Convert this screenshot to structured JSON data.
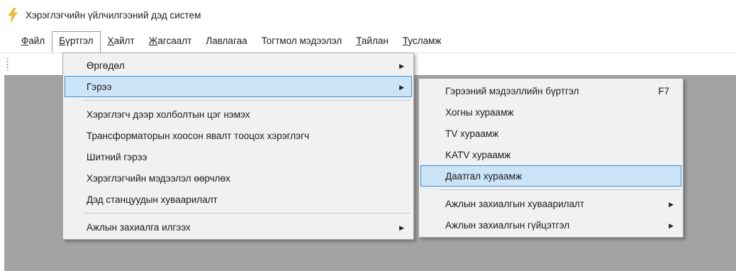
{
  "window": {
    "title": "Хэрэглэгчийн үйлчилгээний дэд систем"
  },
  "menubar": {
    "items": [
      {
        "mn": "Ф",
        "rest": "айл",
        "name": "menu-file"
      },
      {
        "mn": "Б",
        "rest": "үртгэл",
        "name": "menu-burtgel"
      },
      {
        "mn": "Х",
        "rest": "айлт",
        "name": "menu-search"
      },
      {
        "mn": "Ж",
        "rest": "агсаалт",
        "name": "menu-list"
      },
      {
        "mn": "",
        "rest": "Лавлагаа",
        "name": "menu-reference"
      },
      {
        "mn": "",
        "rest": "Тогтмол мэдээлэл",
        "name": "menu-constants"
      },
      {
        "mn": "Т",
        "rest": "айлан",
        "name": "menu-report"
      },
      {
        "mn": "Т",
        "rest": "усламж",
        "name": "menu-help"
      }
    ],
    "active_index": 1
  },
  "burtgel_menu": {
    "items": [
      {
        "label": "Өргөдөл",
        "submenu": true
      },
      {
        "label": "Гэрээ",
        "submenu": true,
        "highlight": true
      },
      {
        "sep": true
      },
      {
        "label": "Хэрэглэгч дээр холболтын цэг нэмэх"
      },
      {
        "label": "Трансформаторын хоосон явалт тооцох хэрэглэгч"
      },
      {
        "label": "Шитний гэрээ"
      },
      {
        "label": "Хэрэглэгчийн мэдээлэл өөрчлөх"
      },
      {
        "label": "Дэд станцуудын хуваарилалт"
      },
      {
        "sep": true
      },
      {
        "label": "Ажлын захиалга илгээх",
        "submenu": true
      }
    ]
  },
  "geree_menu": {
    "items": [
      {
        "label": "Гэрээний мэдээллийн бүртгэл",
        "shortcut": "F7"
      },
      {
        "label": "Хогны хураамж"
      },
      {
        "label": "TV хураамж"
      },
      {
        "label": "KATV хураамж"
      },
      {
        "label": "Даатгал хураамж",
        "highlight": true
      },
      {
        "sep": true
      },
      {
        "label": "Ажлын захиалгын хуваарилалт",
        "submenu": true
      },
      {
        "label": "Ажлын захиалгын гүйцэтгэл",
        "submenu": true
      }
    ]
  },
  "colors": {
    "highlight_fill": "#cce4f7",
    "highlight_border": "#3d8fd6",
    "workspace": "#a3a3a3",
    "menu_bg": "#f1f1f1"
  },
  "icons": {
    "app": "lightning-bolt-icon",
    "submenu": "triangle-right-icon"
  }
}
